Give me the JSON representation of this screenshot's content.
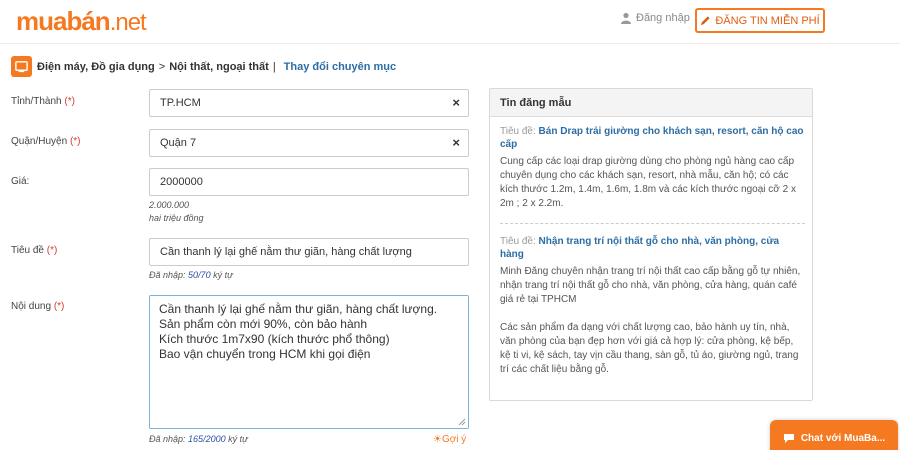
{
  "header": {
    "logo_brand": "muabán",
    "logo_tld": ".net",
    "login_label": "Đăng nhập",
    "post_button_label": "ĐĂNG TIN MIỄN PHÍ"
  },
  "breadcrumb": {
    "items": [
      "Điện máy, Đồ gia dụng",
      "Nội thất, ngoại thất"
    ],
    "separator": ">",
    "divider": "|",
    "change_link": "Thay đổi chuyên mục"
  },
  "form": {
    "province": {
      "label": "Tỉnh/Thành",
      "required": "(*)",
      "value": "TP.HCM"
    },
    "district": {
      "label": "Quận/Huyện",
      "required": "(*)",
      "value": "Quận 7"
    },
    "price": {
      "label": "Giá:",
      "value": "2000000",
      "formatted": "2.000.000",
      "words": "hai triệu đồng"
    },
    "title": {
      "label": "Tiêu đề",
      "required": "(*)",
      "value": "Cần thanh lý lại ghế nằm thư giãn, hàng chất lượng",
      "counter_prefix": "Đã nhập:",
      "counter": "50/70",
      "counter_suffix": "ký tự"
    },
    "content": {
      "label": "Nội dung",
      "required": "(*)",
      "lines": [
        "Cần thanh lý lại ghế nằm thư giãn, hàng chất lượng.",
        "Sản phẩm còn mới 90%, còn bảo hành",
        "Kích thước 1m7x90 (kích thước phổ thông)",
        "Bao vận chuyển trong HCM khi gọi điện"
      ],
      "counter_prefix": "Đã nhập:",
      "counter": "165/2000",
      "counter_suffix": "ký tự",
      "suggest_label": "Gợi ý"
    },
    "clear_symbol": "×"
  },
  "sample_panel": {
    "heading": "Tin đăng mẫu",
    "items": [
      {
        "title_label": "Tiêu đề:",
        "title": "Bán Drap trải giường cho khách sạn, resort, căn hộ cao cấp",
        "body": "Cung cấp các loại drap giường dùng cho phòng ngủ hàng cao cấp chuyên dụng cho các khách sạn, resort, nhà mẫu, căn hộ; có các kích thước 1.2m, 1.4m, 1.6m, 1.8m và các kích thước ngoại cỡ 2 x 2m ; 2 x 2.2m."
      },
      {
        "title_label": "Tiêu đề:",
        "title": "Nhận trang trí nội thất gỗ cho nhà, văn phòng, cửa hàng",
        "body": "Minh Đăng chuyên nhận trang trí nội thất cao cấp bằng gỗ tự nhiên, nhận trang trí nội thất gỗ cho nhà, văn phòng, cửa hàng, quán café giá rẻ tại TPHCM",
        "body2": "Các sản phẩm đa dạng với chất lượng cao, bảo hành uy tín, nhà, văn phòng của bạn đẹp hơn với giá cả hợp lý: cửa phòng, kệ bếp, kệ ti vi, kệ sách, tay vịn cầu thang, sàn gỗ, tủ áo, giường ngủ, trang trí các chất liệu bằng gỗ."
      }
    ]
  },
  "chat": {
    "label": "Chat với MuaBa..."
  },
  "colors": {
    "brand": "#f47920",
    "link": "#2d6da3",
    "required": "#d43a2f"
  },
  "icons": {
    "login": "user-icon",
    "post": "pencil-icon",
    "breadcrumb": "category-icon",
    "suggest": "lightbulb-icon",
    "chat": "chat-bubble-icon"
  }
}
